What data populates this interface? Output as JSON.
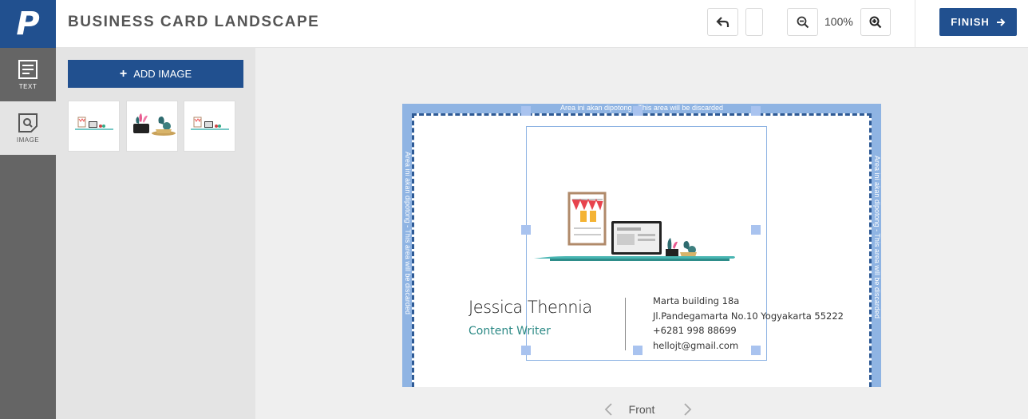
{
  "app": {
    "logo": "P",
    "title": "BUSINESS CARD LANDSCAPE"
  },
  "toolbar": {
    "zoom": "100%",
    "finish_label": "FINISH"
  },
  "rail": {
    "items": [
      {
        "label": "TEXT",
        "icon": "text-icon"
      },
      {
        "label": "IMAGE",
        "icon": "image-icon"
      }
    ]
  },
  "panel": {
    "add_image_label": "ADD IMAGE"
  },
  "card": {
    "bleed_notice": "Area ini akan dipotong - This area will be discarded",
    "name": "Jessica Thennia",
    "role": "Content Writer",
    "address1": "Marta building 18a",
    "address2": "Jl.Pandegamarta No.10 Yogyakarta 55222",
    "phone": "+6281 998 88699",
    "email": "hellojt@gmail.com"
  },
  "pager": {
    "label": "Front"
  },
  "colors": {
    "brand": "#21508f",
    "bleed": "#8fb4e3",
    "accent": "#2d8a86"
  }
}
